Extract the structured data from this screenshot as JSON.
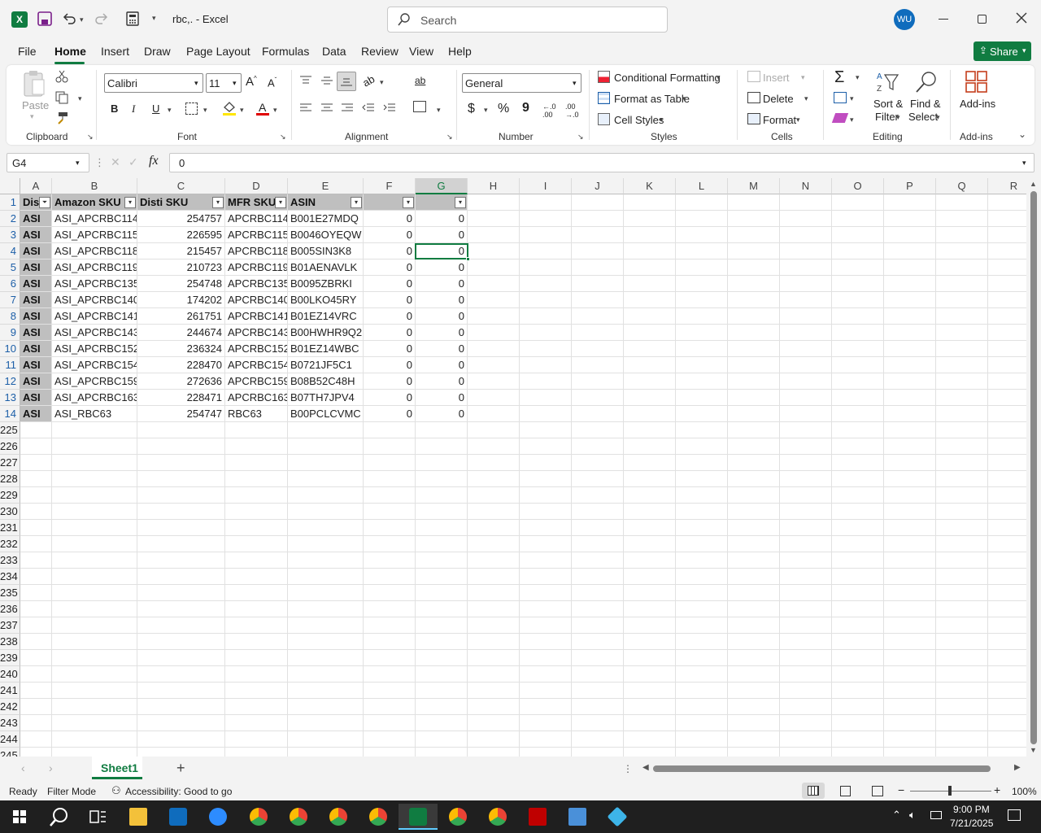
{
  "window": {
    "title": "rbc,. - Excel",
    "search_placeholder": "Search",
    "user_initials": "WU"
  },
  "menu": [
    "File",
    "Home",
    "Insert",
    "Draw",
    "Page Layout",
    "Formulas",
    "Data",
    "Review",
    "View",
    "Help"
  ],
  "share_label": "Share",
  "ribbon": {
    "clipboard": {
      "paste": "Paste",
      "label": "Clipboard"
    },
    "font": {
      "name": "Calibri",
      "size": "11",
      "label": "Font"
    },
    "alignment": {
      "label": "Alignment"
    },
    "number": {
      "format": "General",
      "label": "Number",
      "currency": "$",
      "percent": "%",
      "comma": "9"
    },
    "styles": {
      "conditional": "Conditional Formatting",
      "table": "Format as Table",
      "cell": "Cell Styles",
      "label": "Styles"
    },
    "cells": {
      "insert": "Insert",
      "delete": "Delete",
      "format": "Format",
      "label": "Cells"
    },
    "editing": {
      "sort1": "Sort &",
      "sort2": "Filter",
      "find1": "Find &",
      "find2": "Select",
      "label": "Editing"
    },
    "addins": {
      "button": "Add-ins",
      "label": "Add-ins"
    }
  },
  "formula_bar": {
    "name_box": "G4",
    "fx": "fx",
    "value": "0"
  },
  "columns": [
    "A",
    "B",
    "C",
    "D",
    "E",
    "F",
    "G",
    "H",
    "I",
    "J",
    "K",
    "L",
    "M",
    "N",
    "O",
    "P",
    "Q",
    "R"
  ],
  "table": {
    "headers": [
      "Dis",
      "Amazon SKU",
      "Disti SKU",
      "MFR SKU",
      "ASIN",
      "",
      ""
    ],
    "rows": [
      {
        "n": "2",
        "a": "ASI",
        "b": "ASI_APCRBC114",
        "c": "254757",
        "d": "APCRBC114",
        "e": "B001E27MDQ",
        "f": "0",
        "g": "0"
      },
      {
        "n": "3",
        "a": "ASI",
        "b": "ASI_APCRBC115",
        "c": "226595",
        "d": "APCRBC115",
        "e": "B0046OYEQW",
        "f": "0",
        "g": "0"
      },
      {
        "n": "4",
        "a": "ASI",
        "b": "ASI_APCRBC118",
        "c": "215457",
        "d": "APCRBC118",
        "e": "B005SIN3K8",
        "f": "0",
        "g": "0"
      },
      {
        "n": "5",
        "a": "ASI",
        "b": "ASI_APCRBC119",
        "c": "210723",
        "d": "APCRBC119",
        "e": "B01AENAVLK",
        "f": "0",
        "g": "0"
      },
      {
        "n": "6",
        "a": "ASI",
        "b": "ASI_APCRBC135",
        "c": "254748",
        "d": "APCRBC135",
        "e": "B0095ZBRKI",
        "f": "0",
        "g": "0"
      },
      {
        "n": "7",
        "a": "ASI",
        "b": "ASI_APCRBC140",
        "c": "174202",
        "d": "APCRBC140",
        "e": "B00LKO45RY",
        "f": "0",
        "g": "0"
      },
      {
        "n": "8",
        "a": "ASI",
        "b": "ASI_APCRBC141",
        "c": "261751",
        "d": "APCRBC141",
        "e": "B01EZ14VRC",
        "f": "0",
        "g": "0"
      },
      {
        "n": "9",
        "a": "ASI",
        "b": "ASI_APCRBC143",
        "c": "244674",
        "d": "APCRBC143",
        "e": "B00HWHR9Q2",
        "f": "0",
        "g": "0"
      },
      {
        "n": "10",
        "a": "ASI",
        "b": "ASI_APCRBC152",
        "c": "236324",
        "d": "APCRBC152",
        "e": "B01EZ14WBC",
        "f": "0",
        "g": "0"
      },
      {
        "n": "11",
        "a": "ASI",
        "b": "ASI_APCRBC154",
        "c": "228470",
        "d": "APCRBC154",
        "e": "B0721JF5C1",
        "f": "0",
        "g": "0"
      },
      {
        "n": "12",
        "a": "ASI",
        "b": "ASI_APCRBC159",
        "c": "272636",
        "d": "APCRBC159",
        "e": "B08B52C48H",
        "f": "0",
        "g": "0"
      },
      {
        "n": "13",
        "a": "ASI",
        "b": "ASI_APCRBC163",
        "c": "228471",
        "d": "APCRBC163",
        "e": "B07TH7JPV4",
        "f": "0",
        "g": "0"
      },
      {
        "n": "14",
        "a": "ASI",
        "b": "ASI_RBC63",
        "c": "254747",
        "d": "RBC63",
        "e": "B00PCLCVMC",
        "f": "0",
        "g": "0"
      }
    ],
    "empty_rows": [
      "225",
      "226",
      "227",
      "228",
      "229",
      "230",
      "231",
      "232",
      "233",
      "234",
      "235",
      "236",
      "237",
      "238",
      "239",
      "240",
      "241",
      "242",
      "243",
      "244",
      "245"
    ]
  },
  "sheet_tab": "Sheet1",
  "status": {
    "ready": "Ready",
    "mode": "Filter Mode",
    "accessibility": "Accessibility: Good to go",
    "zoom": "100%"
  },
  "taskbar": {
    "time": "9:00 PM",
    "date": "7/21/2025"
  },
  "colors": {
    "excel_green": "#107c41",
    "header_fill": "#bfbfbf",
    "row_blue": "#1d5fa8"
  }
}
